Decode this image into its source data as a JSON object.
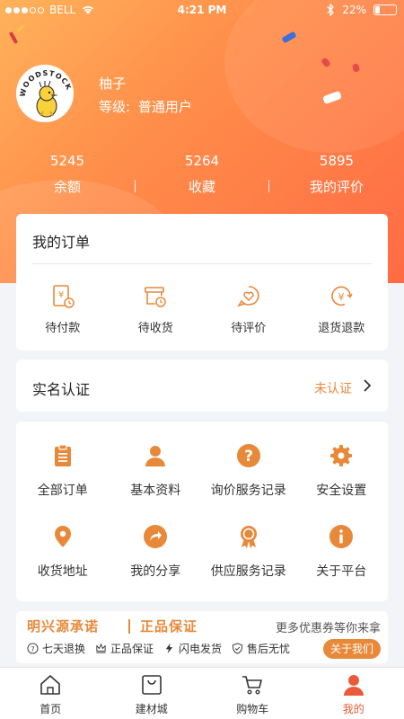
{
  "status_bar": {
    "carrier": "BELL",
    "time": "4:21 PM",
    "battery": "22%",
    "battery_fraction": 0.22
  },
  "profile": {
    "avatar_text": "WOODSTOCK",
    "name": "柚子",
    "level_label": "等级:",
    "level_value": "普通用户"
  },
  "stats": [
    {
      "value": "5245",
      "label": "余额"
    },
    {
      "value": "5264",
      "label": "收藏"
    },
    {
      "value": "5895",
      "label": "我的评价"
    }
  ],
  "orders": {
    "title": "我的订单",
    "items": [
      {
        "label": "待付款",
        "icon": "pending-payment-icon"
      },
      {
        "label": "待收货",
        "icon": "pending-delivery-icon"
      },
      {
        "label": "待评价",
        "icon": "pending-review-icon"
      },
      {
        "label": "退货退款",
        "icon": "refund-icon"
      }
    ]
  },
  "verification": {
    "title": "实名认证",
    "status": "未认证"
  },
  "menu": [
    {
      "label": "全部订单",
      "icon": "clipboard-icon"
    },
    {
      "label": "基本资料",
      "icon": "person-icon"
    },
    {
      "label": "询价服务记录",
      "icon": "question-icon"
    },
    {
      "label": "安全设置",
      "icon": "gear-icon"
    },
    {
      "label": "收货地址",
      "icon": "location-pin-icon"
    },
    {
      "label": "我的分享",
      "icon": "share-icon"
    },
    {
      "label": "供应服务记录",
      "icon": "award-ribbon-icon"
    },
    {
      "label": "关于平台",
      "icon": "info-icon"
    }
  ],
  "promise": {
    "title": "明兴源承诺",
    "title2": "正品保证",
    "more": "更多优惠券等你来拿",
    "points": [
      "七天退换",
      "正品保证",
      "闪电发货",
      "售后无忧"
    ],
    "about_button": "关于我们"
  },
  "tabs": [
    {
      "label": "首页",
      "icon": "home-icon"
    },
    {
      "label": "建材城",
      "icon": "shopping-bag-icon"
    },
    {
      "label": "购物车",
      "icon": "cart-icon"
    },
    {
      "label": "我的",
      "icon": "profile-icon"
    }
  ],
  "colors": {
    "accent": "#e8893a",
    "active_tab": "#e95a3a",
    "hero_start": "#ffb25b",
    "hero_end": "#ff6b44"
  }
}
